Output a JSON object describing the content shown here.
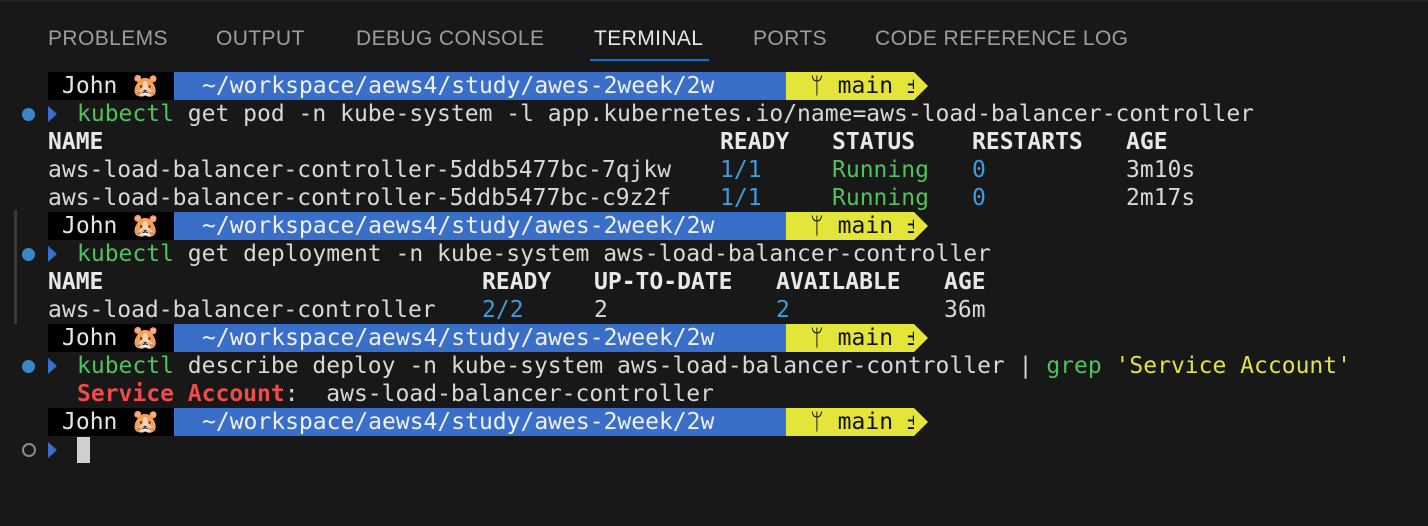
{
  "tabs": [
    "PROBLEMS",
    "OUTPUT",
    "DEBUG CONSOLE",
    "TERMINAL",
    "PORTS",
    "CODE REFERENCE LOG"
  ],
  "active_tab": "TERMINAL",
  "prompt": {
    "user": "John 🐹",
    "path": "~/workspace/aews4/study/awes-2week/2w",
    "branch": "ᛘ main ±"
  },
  "cmd1": {
    "bin": "kubectl",
    "args": " get pod -n kube-system -l app.kubernetes.io/name=aws-load-balancer-controller",
    "headers": [
      "NAME",
      "READY",
      "STATUS",
      "RESTARTS",
      "AGE"
    ],
    "rows": [
      [
        "aws-load-balancer-controller-5ddb5477bc-7qjkw",
        "1/1",
        "Running",
        "0",
        "3m10s"
      ],
      [
        "aws-load-balancer-controller-5ddb5477bc-c9z2f",
        "1/1",
        "Running",
        "0",
        "2m17s"
      ]
    ]
  },
  "cmd2": {
    "bin": "kubectl",
    "args": " get deployment -n kube-system aws-load-balancer-controller",
    "headers": [
      "NAME",
      "READY",
      "UP-TO-DATE",
      "AVAILABLE",
      "AGE"
    ],
    "rows": [
      [
        "aws-load-balancer-controller",
        "2/2",
        "2",
        "2",
        "36m"
      ]
    ]
  },
  "cmd3": {
    "bin": "kubectl",
    "args": " describe deploy -n kube-system aws-load-balancer-controller | ",
    "grep": "grep",
    "pattern": " 'Service Account'",
    "result_key": "Service Account",
    "result_value": ":  aws-load-balancer-controller"
  },
  "colors": {
    "background": "#181818",
    "prompt_user_bg": "#000000",
    "prompt_path_bg": "#3a6fc9",
    "prompt_git_bg": "#e4e53a",
    "command_green": "#4fc35a",
    "number_blue": "#3b9ce0",
    "match_red": "#f04a4a",
    "tab_underline": "#0078d4"
  }
}
